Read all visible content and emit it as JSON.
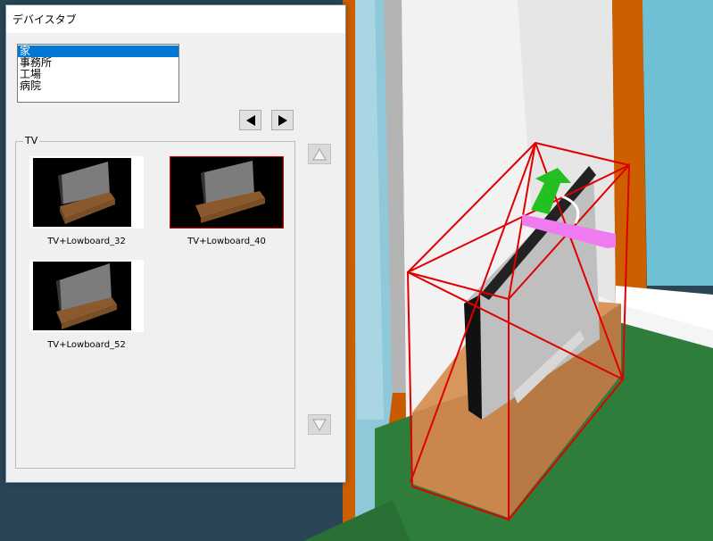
{
  "dialog": {
    "title": "デバイスタブ",
    "categories": [
      {
        "label": "家",
        "selected": true
      },
      {
        "label": "事務所",
        "selected": false
      },
      {
        "label": "工場",
        "selected": false
      },
      {
        "label": "病院",
        "selected": false
      }
    ],
    "nav": {
      "prev_icon": "triangle-left-icon",
      "next_icon": "triangle-right-icon"
    },
    "group": {
      "label": "TV",
      "devices": [
        {
          "label": "TV+Lowboard_32",
          "selected": false
        },
        {
          "label": "TV+Lowboard_40",
          "selected": true
        },
        {
          "label": "TV+Lowboard_52",
          "selected": false
        }
      ]
    },
    "scroll": {
      "up_icon": "scroll-up-icon",
      "down_icon": "scroll-down-icon"
    }
  },
  "colors": {
    "selection": "#0078d7",
    "selected_border": "#d00000",
    "window_frame": "#c85a00",
    "floor": "#2e7d3a",
    "bounding_box": "#e00000",
    "move_arrow": "#22c020",
    "rotate_handle": "#f07af0"
  }
}
